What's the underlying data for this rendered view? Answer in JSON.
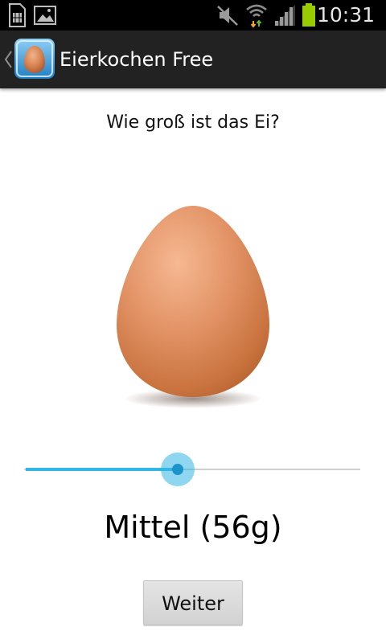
{
  "status_bar": {
    "time": "10:31",
    "icons": [
      "sim-card-icon",
      "gallery-icon",
      "mute-icon",
      "wifi-icon",
      "signal-icon",
      "battery-icon"
    ]
  },
  "action_bar": {
    "title": "Eierkochen Free",
    "app_icon": "egg-app-icon",
    "up_icon": "back-caret-icon"
  },
  "main": {
    "question": "Wie groß ist das Ei?",
    "egg_image": "brown-egg",
    "slider": {
      "value": 0.457
    },
    "size_value": "Mittel (56g)",
    "next_label": "Weiter"
  },
  "colors": {
    "status_bar": "#000000",
    "action_bar": "#222222",
    "accent": "#33b5e5",
    "battery": "#99cc00",
    "background": "#ffffff"
  }
}
